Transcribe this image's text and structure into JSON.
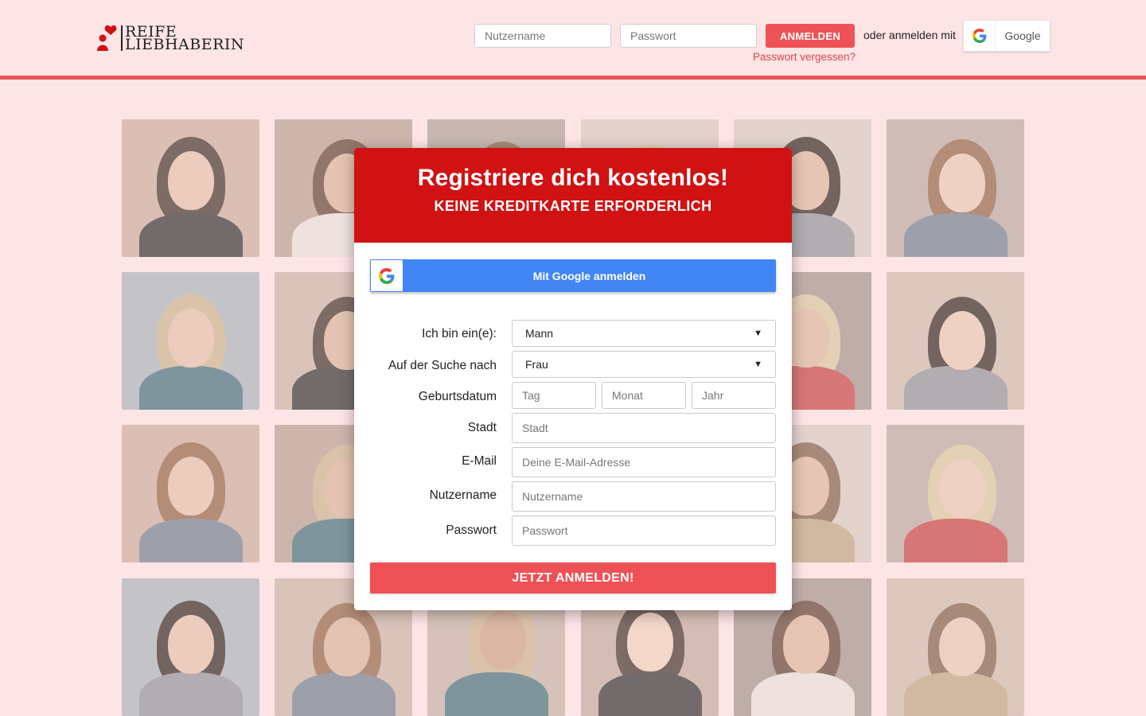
{
  "header": {
    "logo_line1": "REIFE",
    "logo_line2": "LIEBHABERIN",
    "username_placeholder": "Nutzername",
    "password_placeholder": "Passwort",
    "login_button": "ANMELDEN",
    "or_login_with": "oder anmelden mit",
    "google_label": "Google",
    "forgot_password": "Passwort vergessen?"
  },
  "modal": {
    "title": "Registriere dich kostenlos!",
    "subtitle": "KEINE KREDITKARTE ERFORDERLICH",
    "google_button": "Mit Google anmelden",
    "fields": {
      "i_am_label": "Ich bin ein(e):",
      "i_am_value": "Mann",
      "seeking_label": "Auf der Suche nach",
      "seeking_value": "Frau",
      "birthdate_label": "Geburtsdatum",
      "day_placeholder": "Tag",
      "month_placeholder": "Monat",
      "year_placeholder": "Jahr",
      "city_label": "Stadt",
      "city_placeholder": "Stadt",
      "email_label": "E-Mail",
      "email_placeholder": "Deine E-Mail-Adresse",
      "username_label": "Nutzername",
      "username_placeholder": "Nutzername",
      "password_label": "Passwort",
      "password_placeholder": "Passwort"
    },
    "submit": "JETZT ANMELDEN!"
  },
  "colors": {
    "background": "#fde4e5",
    "accent": "#ef5256",
    "header_red": "#d01213",
    "google_blue": "#4285f4"
  }
}
